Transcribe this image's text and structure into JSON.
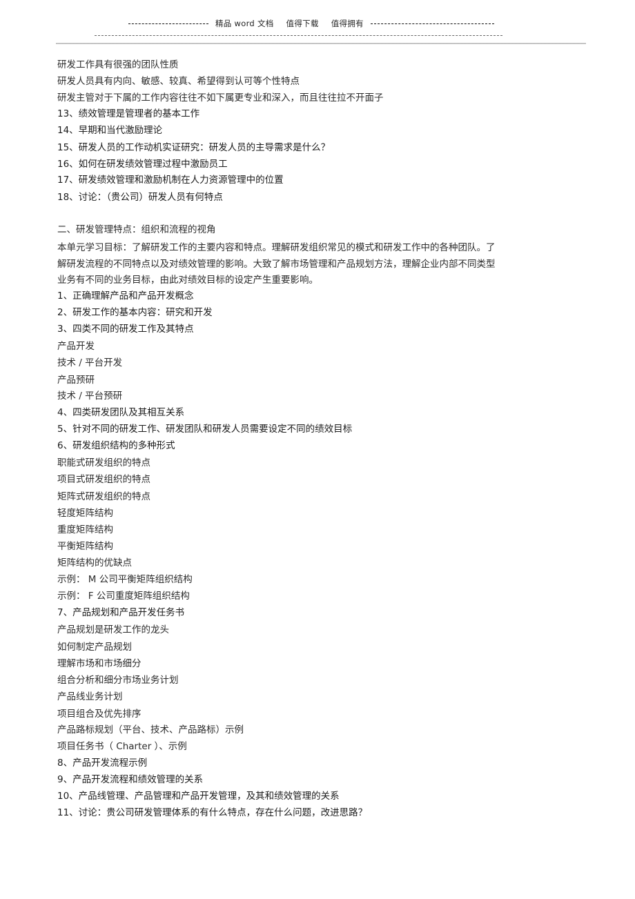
{
  "header": {
    "text_parts": [
      "精品 word 文档",
      "值得下载",
      "值得拥有"
    ]
  },
  "section1_tail": [
    "研发工作具有很强的团队性质",
    "研发人员具有内向、敏感、较真、希望得到认可等个性特点",
    "研发主管对于下属的工作内容往往不如下属更专业和深入，而且往往拉不开面子",
    "13、绩效管理是管理者的基本工作",
    "14、早期和当代激励理论",
    "15、研发人员的工作动机实证研究：研发人员的主导需求是什么？",
    "16、如何在研发绩效管理过程中激励员工",
    "17、研发绩效管理和激励机制在人力资源管理中的位置",
    "18、讨论：（贵公司）研发人员有何特点"
  ],
  "section2": {
    "heading": "二、研发管理特点：组织和流程的视角",
    "objective": "本单元学习目标：了解研发工作的主要内容和特点。理解研发组织常见的模式和研发工作中的各种团队。了解研发流程的不同特点以及对绩效管理的影响。大致了解市场管理和产品规划方法，理解企业内部不同类型业务有不同的业务目标，由此对绩效目标的设定产生重要影响。",
    "objective_lines": [
      "本单元学习目标：了解研发工作的主要内容和特点。理解研发组织常见的模式和研发工作中的各种团队。了",
      "解研发流程的不同特点以及对绩效管理的影响。大致了解市场管理和产品规划方法，理解企业内部不同类型",
      "业务有不同的业务目标，由此对绩效目标的设定产生重要影响。"
    ],
    "items": [
      "1、正确理解产品和产品开发概念",
      "2、研发工作的基本内容：研究和开发",
      "3、四类不同的研发工作及其特点",
      "产品开发",
      "技术 / 平台开发",
      "产品预研",
      "技术 / 平台预研",
      "4、四类研发团队及其相互关系",
      "5、针对不同的研发工作、研发团队和研发人员需要设定不同的绩效目标",
      "6、研发组织结构的多种形式",
      "职能式研发组织的特点",
      "项目式研发组织的特点",
      "矩阵式研发组织的特点",
      "轻度矩阵结构",
      "重度矩阵结构",
      "平衡矩阵结构",
      "矩阵结构的优缺点",
      "示例：  M 公司平衡矩阵组织结构",
      "示例：  F 公司重度矩阵组织结构",
      "7、产品规划和产品开发任务书",
      "产品规划是研发工作的龙头",
      "如何制定产品规划",
      "理解市场和市场细分",
      "组合分析和细分市场业务计划",
      "产品线业务计划",
      "项目组合及优先排序",
      "产品路标规划（平台、技术、产品路标）示例",
      "项目任务书（  Charter ）、示例",
      "8、产品开发流程示例",
      "9、产品开发流程和绩效管理的关系",
      "10、产品线管理、产品管理和产品开发管理，及其和绩效管理的关系",
      "11、讨论：贵公司研发管理体系的有什么特点，存在什么问题，改进思路？"
    ]
  }
}
